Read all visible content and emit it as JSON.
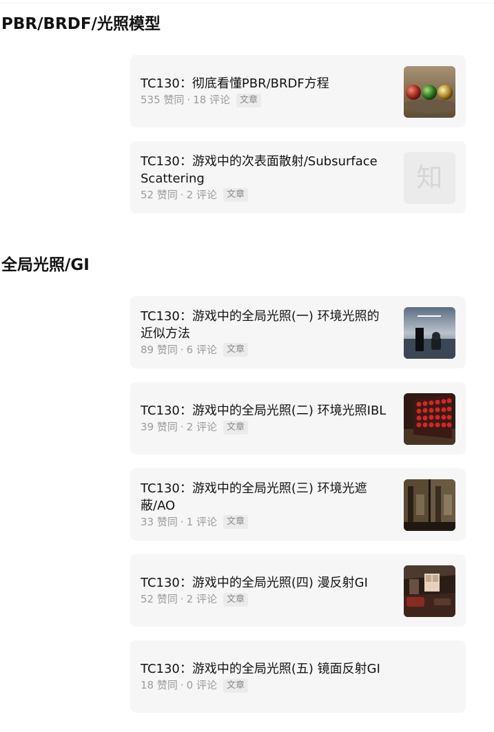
{
  "sections": [
    {
      "title": "PBR/BRDF/光照模型",
      "cards": [
        {
          "title": "TC130：彻底看懂PBR/BRDF方程",
          "likes": "535 赞同",
          "comments": "18 评论",
          "tag": "文章",
          "thumb": "pbr-spheres-thumbnail"
        },
        {
          "title": "TC130：游戏中的次表面散射/Subsurface Scattering",
          "likes": "52 赞同",
          "comments": "2 评论",
          "tag": "文章",
          "thumb": "zhihu-logo-placeholder",
          "thumb_glyph": "知"
        }
      ]
    },
    {
      "title": "全局光照/GI",
      "cards": [
        {
          "title": "TC130：游戏中的全局光照(一) 环境光照的近似方法",
          "likes": "89 赞同",
          "comments": "6 评论",
          "tag": "文章",
          "thumb": "ambient-scene-thumbnail"
        },
        {
          "title": "TC130：游戏中的全局光照(二) 环境光照IBL",
          "likes": "39 赞同",
          "comments": "2 评论",
          "tag": "文章",
          "thumb": "red-spheres-grid-thumbnail"
        },
        {
          "title": "TC130：游戏中的全局光照(三) 环境光遮蔽/AO",
          "likes": "33 赞同",
          "comments": "1 评论",
          "tag": "文章",
          "thumb": "ao-comparison-thumbnail"
        },
        {
          "title": "TC130：游戏中的全局光照(四) 漫反射GI",
          "likes": "52 赞同",
          "comments": "2 评论",
          "tag": "文章",
          "thumb": "diffuse-room-thumbnail"
        },
        {
          "title": "TC130：游戏中的全局光照(五) 镜面反射GI",
          "likes": "18 赞同",
          "comments": "0 评论",
          "tag": "文章"
        }
      ]
    }
  ],
  "meta_separator": "·"
}
